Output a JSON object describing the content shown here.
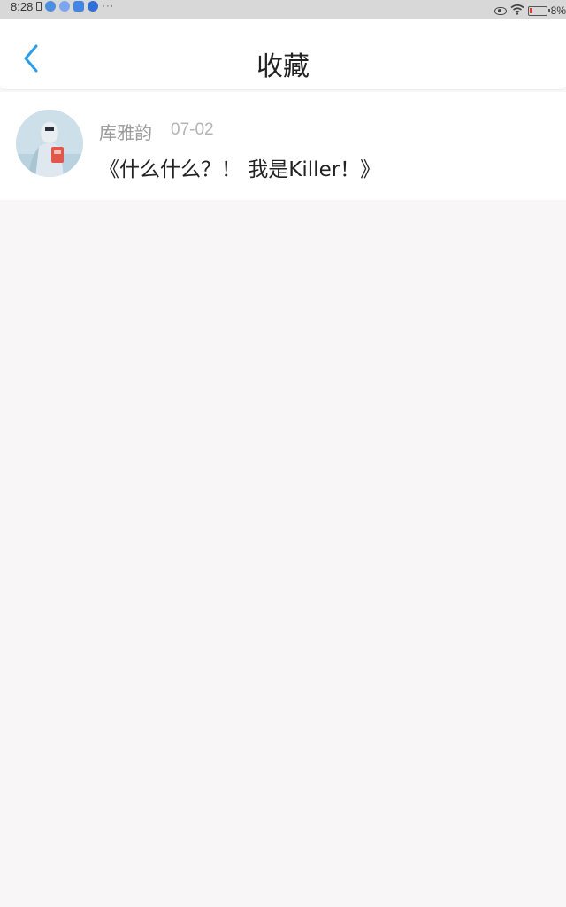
{
  "status_bar": {
    "time": "8:28",
    "more": "···",
    "battery": "8%",
    "icons": [
      "phone-icon",
      "app-icon",
      "app-icon",
      "cloud-icon",
      "app-icon",
      "eye-icon",
      "wifi-icon",
      "battery-icon"
    ]
  },
  "header": {
    "title": "收藏",
    "back_icon": "chevron-left-icon",
    "accent_color": "#2a9ee8"
  },
  "favorites": [
    {
      "author": "库雅韵",
      "date": "07-02",
      "title": "《什么什么？！ 我是Killer！》",
      "avatar": "avatar-image"
    }
  ]
}
